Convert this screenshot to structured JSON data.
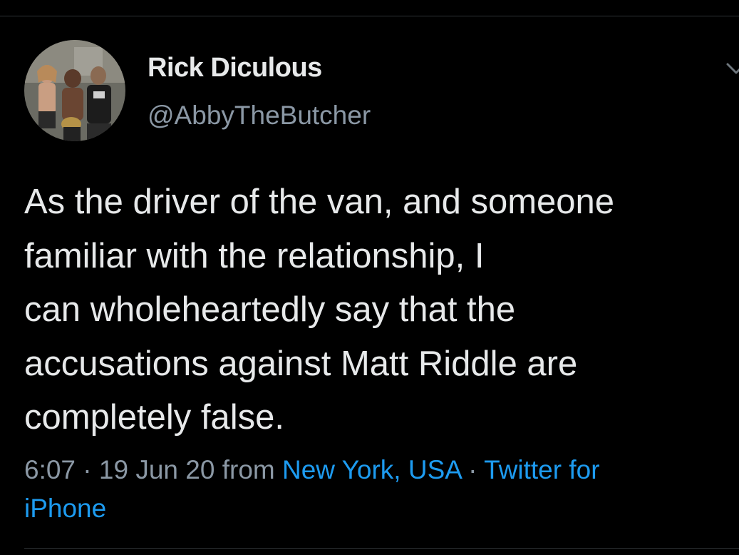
{
  "colors": {
    "background": "#000000",
    "text": "#e7e9ea",
    "secondary": "#8b98a5",
    "link": "#1d9bf0",
    "divider": "#2f3336"
  },
  "author": {
    "display_name": "Rick Diculous",
    "handle": "@AbbyTheButcher",
    "avatar_icon": "avatar-photo"
  },
  "menu": {
    "icon": "chevron-down-icon"
  },
  "tweet": {
    "lines": [
      "As the driver of the van, and someone",
      "familiar with the relationship, I",
      "can wholeheartedly say that the",
      "accusations against Matt Riddle are",
      "completely false."
    ]
  },
  "meta": {
    "time": "6:07",
    "separator": " · ",
    "date": "19 Jun 20",
    "from_label": " from ",
    "location": "New York, USA",
    "source_line1": "Twitter for",
    "source_line2": "iPhone"
  }
}
